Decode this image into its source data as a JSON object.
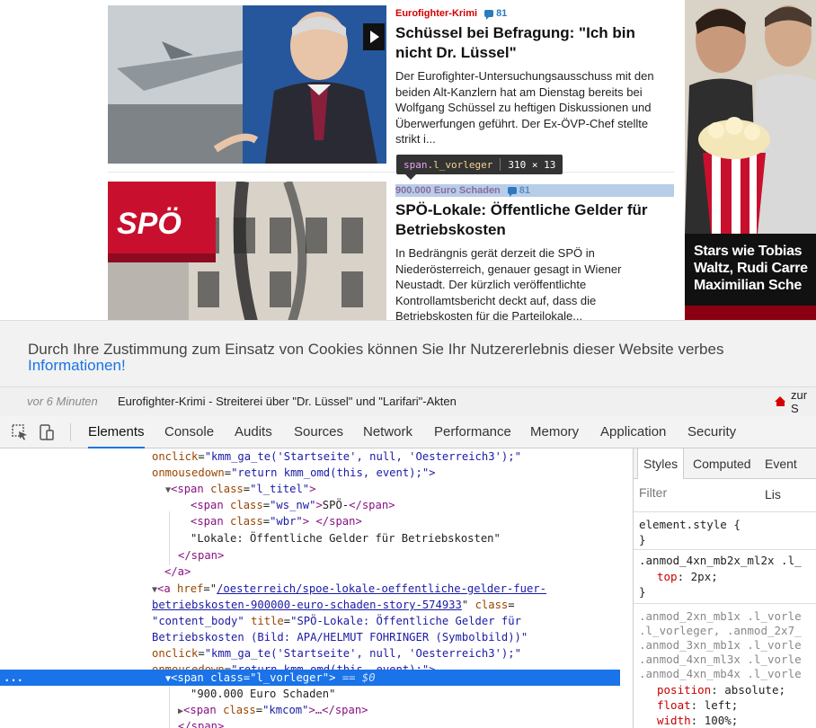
{
  "articles": [
    {
      "kicker": "Eurofighter-Krimi",
      "comments": "81",
      "headline": "Schüssel bei Befragung: \"Ich bin nicht Dr. Lüssel\"",
      "teaser": "Der Eurofighter-Untersuchungsausschuss mit den beiden Alt-Kanzlern hat am Dienstag bereits bei Wolfgang Schüssel zu heftigen Diskussionen und Überwerfungen geführt. Der Ex-ÖVP-Chef stellte strikt i..."
    },
    {
      "kicker": "900.000 Euro Schaden",
      "comments": "81",
      "headline": "SPÖ-Lokale: Öffentliche Gelder für Betriebskosten",
      "teaser": "In Bedrängnis gerät derzeit die SPÖ in Niederösterreich, genauer gesagt in Wiener Neustadt. Der kürzlich veröffentlichte Kontrollamtsbericht deckt auf, dass die Betriebskosten für die Parteilokale..."
    }
  ],
  "image2_sign": "SPÖ",
  "tooltip": {
    "tag": "span",
    "class": ".l_vorleger",
    "size": "310 × 13"
  },
  "ad": {
    "text": "Stars wie Tobias Waltz, Rudi Carre Maximilian Sche"
  },
  "cookie": {
    "message": "Durch Ihre Zustimmung zum Einsatz von Cookies können Sie Ihr Nutzererlebnis dieser Website verbes",
    "link": "Informationen!"
  },
  "ticker": {
    "time": "vor 6 Minuten",
    "text": "Eurofighter-Krimi - Streiterei über \"Dr. Lüssel\" und \"Larifari\"-Akten",
    "home": "zur S"
  },
  "devtools": {
    "tabs": [
      "Elements",
      "Console",
      "Audits",
      "Sources",
      "Network",
      "Performance",
      "Memory",
      "Application",
      "Security"
    ],
    "active_tab": "Elements",
    "styles_tabs": [
      "Styles",
      "Computed",
      "Event Lis"
    ],
    "filter_placeholder": "Filter",
    "code": {
      "l1_attr": "onclick",
      "l1_val": "\"kmm_ga_te('Startseite', null, 'Oesterreich3');\"",
      "l2_attr": "onmousedown",
      "l2_val": "\"return kmm_omd(this, event);\">",
      "l3_tag_open": "<span ",
      "l3_attr": "class",
      "l3_val": "\"l_titel\"",
      "l3_tag_close": ">",
      "l4_tag": "<span ",
      "l4_attr": "class",
      "l4_val": "\"ws_nw\"",
      "l4_text": "SPÖ-",
      "l4_close": "</span>",
      "l5_tag": "<span ",
      "l5_attr": "class",
      "l5_val": "\"wbr\"",
      "l5_text": " ",
      "l5_close": "</span>",
      "l6_text": "\"Lokale: Öffentliche Gelder für Betriebskosten\"",
      "l7": "</span>",
      "l8": "</a>",
      "l9_tag": "<a ",
      "l9_attr": "href",
      "l9_val": "/oesterreich/spoe-lokale-oeffentliche-gelder-fuer-",
      "l10_val": "betriebskosten-900000-euro-schaden-story-574933",
      "l10_attr": "class",
      "l11_val": "\"content_body\"",
      "l11_attr": "title",
      "l11_val2": "\"SPÖ-Lokale: Öffentliche Gelder für",
      "l12_val": "Betriebskosten (Bild: APA/HELMUT FOHRINGER (Symbolbild))\"",
      "l13_attr": "onclick",
      "l13_val": "\"kmm_ga_te('Startseite', null, 'Oesterreich3');\"",
      "l14_attr": "onmousedown",
      "l14_val": "\"return kmm_omd(this, event);\">",
      "l15_tag": "<span ",
      "l15_attr": "class",
      "l15_val": "\"l_vorleger\"",
      "l15_eq": "== $0",
      "l16_text": "\"900.000 Euro Schaden\"",
      "l17_tag": "<span ",
      "l17_attr": "class",
      "l17_val": "\"kmcom\"",
      "l17_rest": "…</span>",
      "l18": "</span>",
      "dots": "..."
    },
    "styles": {
      "element_style": "element.style {",
      "close1": "}",
      "rule2_sel": ".anmod_4xn_mb2x_ml2x .l_",
      "rule2_prop": "top",
      "rule2_val": "2px;",
      "close2": "}",
      "rule3_sel1": ".anmod_2xn_mb1x .l_vorle",
      "rule3_sel2": ".l_vorleger, .anmod_2x7_",
      "rule3_sel3": ".anmod_3xn_mb1x .l_vorle",
      "rule3_sel4": ".anmod_4xn_ml3x .l_vorle",
      "rule3_sel5": ".anmod_4xn_mb4x .l_vorle",
      "p1": "position",
      "v1": "absolute;",
      "p2": "float",
      "v2": "left;",
      "p3": "width",
      "v3": "100%;"
    }
  }
}
